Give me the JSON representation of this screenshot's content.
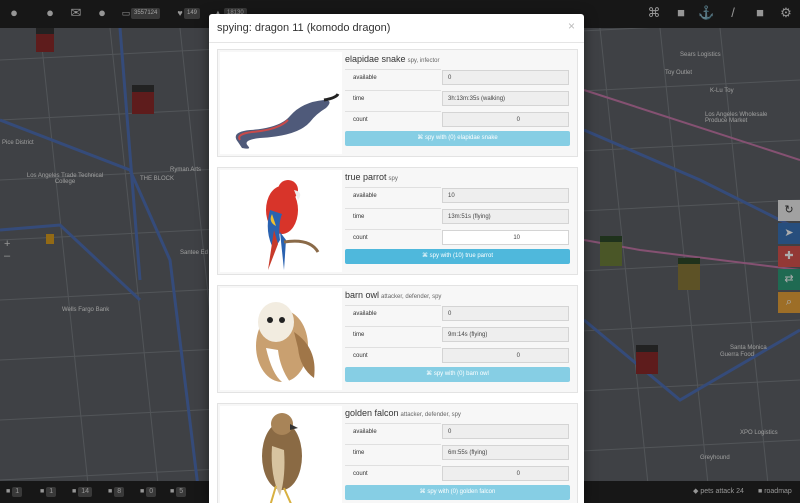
{
  "top_bar": {
    "icons": [
      "paw-icon",
      "user-icon",
      "envelope-icon",
      "paw-group-icon",
      "money-icon",
      "heart-icon",
      "chart-icon"
    ],
    "counters": [
      "3557124",
      "149",
      "18130"
    ],
    "right_icons": [
      "binoculars-icon",
      "lock-icon",
      "anchor-icon",
      "eyedropper-icon",
      "gift-icon",
      "settings-icon"
    ]
  },
  "map_labels": {
    "l1": "Pice District",
    "l2": "Los Angeles Trade Technical College",
    "l3": "THE BLOCK",
    "l4": "Wells Fargo Bank",
    "l5": "Ryman Arts",
    "l6": "Santee Ed",
    "l7": "Los Angeles Wholesale Produce Market",
    "l8": "Sears Logistics",
    "l9": "K-Lu Toy",
    "l10": "Toy Outlet",
    "l11": "Guerra Food",
    "l12": "Santa Monica",
    "l13": "XPO Logistics",
    "l14": "Greyhound"
  },
  "modal": {
    "title": "spying: dragon 11 (komodo dragon)",
    "close": "×",
    "cards": [
      {
        "name": "elapidae snake",
        "tags": "spy, infector",
        "available_label": "available",
        "available": "0",
        "time_label": "time",
        "time": "3h:13m:35s (walking)",
        "count_label": "count",
        "count": "0",
        "button": "spy with (0) elapidae snake"
      },
      {
        "name": "true parrot",
        "tags": "spy",
        "available_label": "available",
        "available": "10",
        "time_label": "time",
        "time": "13m:51s (flying)",
        "count_label": "count",
        "count": "10",
        "button": "spy with (10) true parrot"
      },
      {
        "name": "barn owl",
        "tags": "attacker, defender, spy",
        "available_label": "available",
        "available": "0",
        "time_label": "time",
        "time": "9m:14s (flying)",
        "count_label": "count",
        "count": "0",
        "button": "spy with (0) barn owl"
      },
      {
        "name": "golden falcon",
        "tags": "attacker, defender, spy",
        "available_label": "available",
        "available": "0",
        "time_label": "time",
        "time": "6m:55s (flying)",
        "count_label": "count",
        "count": "0",
        "button": "spy with (0) golden falcon"
      }
    ]
  },
  "bottom_bar": {
    "counts": [
      "1",
      "1",
      "14",
      "8",
      "0",
      "5"
    ],
    "brand": "pets attack 24",
    "roadmap": "roadmap"
  },
  "colors": {
    "accent": "#5bc0de",
    "accent_disabled": "#86cee4",
    "bar": "#222222"
  }
}
